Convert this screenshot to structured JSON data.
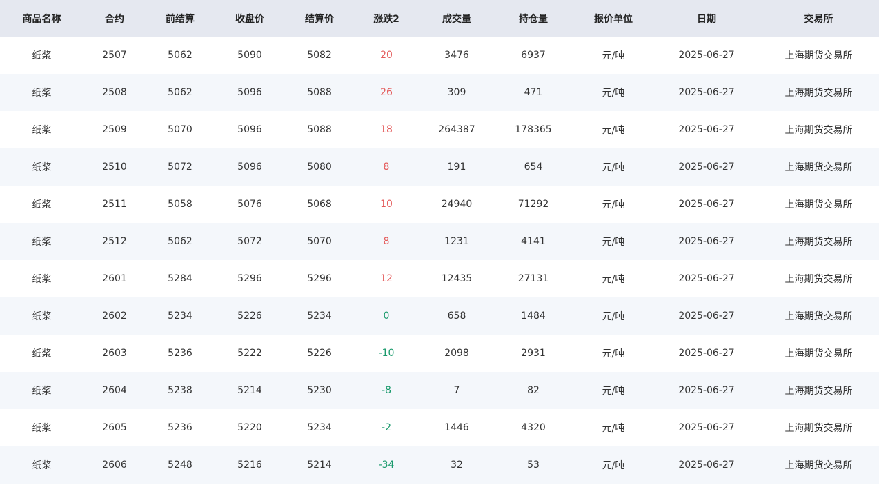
{
  "colors": {
    "header_bg": "#e5e8f0",
    "row_alt_bg": "#f4f7fb",
    "up": "#e45b5b",
    "down": "#1a9a6c"
  },
  "table": {
    "columns": [
      "商品名称",
      "合约",
      "前结算",
      "收盘价",
      "结算价",
      "涨跌2",
      "成交量",
      "持仓量",
      "报价单位",
      "日期",
      "交易所"
    ],
    "rows": [
      {
        "name": "纸浆",
        "contract": "2507",
        "prev_settle": "5062",
        "close": "5090",
        "settle": "5082",
        "change": "20",
        "volume": "3476",
        "open_interest": "6937",
        "unit": "元/吨",
        "date": "2025-06-27",
        "exchange": "上海期货交易所"
      },
      {
        "name": "纸浆",
        "contract": "2508",
        "prev_settle": "5062",
        "close": "5096",
        "settle": "5088",
        "change": "26",
        "volume": "309",
        "open_interest": "471",
        "unit": "元/吨",
        "date": "2025-06-27",
        "exchange": "上海期货交易所"
      },
      {
        "name": "纸浆",
        "contract": "2509",
        "prev_settle": "5070",
        "close": "5096",
        "settle": "5088",
        "change": "18",
        "volume": "264387",
        "open_interest": "178365",
        "unit": "元/吨",
        "date": "2025-06-27",
        "exchange": "上海期货交易所"
      },
      {
        "name": "纸浆",
        "contract": "2510",
        "prev_settle": "5072",
        "close": "5096",
        "settle": "5080",
        "change": "8",
        "volume": "191",
        "open_interest": "654",
        "unit": "元/吨",
        "date": "2025-06-27",
        "exchange": "上海期货交易所"
      },
      {
        "name": "纸浆",
        "contract": "2511",
        "prev_settle": "5058",
        "close": "5076",
        "settle": "5068",
        "change": "10",
        "volume": "24940",
        "open_interest": "71292",
        "unit": "元/吨",
        "date": "2025-06-27",
        "exchange": "上海期货交易所"
      },
      {
        "name": "纸浆",
        "contract": "2512",
        "prev_settle": "5062",
        "close": "5072",
        "settle": "5070",
        "change": "8",
        "volume": "1231",
        "open_interest": "4141",
        "unit": "元/吨",
        "date": "2025-06-27",
        "exchange": "上海期货交易所"
      },
      {
        "name": "纸浆",
        "contract": "2601",
        "prev_settle": "5284",
        "close": "5296",
        "settle": "5296",
        "change": "12",
        "volume": "12435",
        "open_interest": "27131",
        "unit": "元/吨",
        "date": "2025-06-27",
        "exchange": "上海期货交易所"
      },
      {
        "name": "纸浆",
        "contract": "2602",
        "prev_settle": "5234",
        "close": "5226",
        "settle": "5234",
        "change": "0",
        "volume": "658",
        "open_interest": "1484",
        "unit": "元/吨",
        "date": "2025-06-27",
        "exchange": "上海期货交易所"
      },
      {
        "name": "纸浆",
        "contract": "2603",
        "prev_settle": "5236",
        "close": "5222",
        "settle": "5226",
        "change": "-10",
        "volume": "2098",
        "open_interest": "2931",
        "unit": "元/吨",
        "date": "2025-06-27",
        "exchange": "上海期货交易所"
      },
      {
        "name": "纸浆",
        "contract": "2604",
        "prev_settle": "5238",
        "close": "5214",
        "settle": "5230",
        "change": "-8",
        "volume": "7",
        "open_interest": "82",
        "unit": "元/吨",
        "date": "2025-06-27",
        "exchange": "上海期货交易所"
      },
      {
        "name": "纸浆",
        "contract": "2605",
        "prev_settle": "5236",
        "close": "5220",
        "settle": "5234",
        "change": "-2",
        "volume": "1446",
        "open_interest": "4320",
        "unit": "元/吨",
        "date": "2025-06-27",
        "exchange": "上海期货交易所"
      },
      {
        "name": "纸浆",
        "contract": "2606",
        "prev_settle": "5248",
        "close": "5216",
        "settle": "5214",
        "change": "-34",
        "volume": "32",
        "open_interest": "53",
        "unit": "元/吨",
        "date": "2025-06-27",
        "exchange": "上海期货交易所"
      }
    ]
  }
}
